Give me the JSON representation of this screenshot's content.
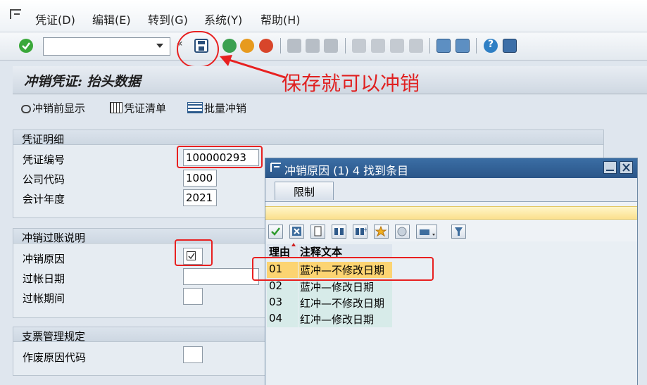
{
  "menu": {
    "items": [
      "凭证(D)",
      "编辑(E)",
      "转到(G)",
      "系统(Y)",
      "帮助(H)"
    ]
  },
  "command_field": {
    "value": ""
  },
  "page": {
    "title": "冲销凭证: 抬头数据",
    "annotation": "保存就可以冲销"
  },
  "app_toolbar": {
    "btn_preview": "冲销前显示",
    "btn_list": "凭证清单",
    "btn_mass": "批量冲销"
  },
  "group_doc": {
    "header": "凭证明细",
    "doc_number_label": "凭证编号",
    "doc_number_value": "100000293",
    "company_code_label": "公司代码",
    "company_code_value": "1000",
    "fiscal_year_label": "会计年度",
    "fiscal_year_value": "2021"
  },
  "group_posting": {
    "header": "冲销过账说明",
    "reason_label": "冲销原因",
    "reason_value": "",
    "posting_date_label": "过帐日期",
    "posting_date_value": "",
    "posting_period_label": "过帐期间",
    "posting_period_value": ""
  },
  "group_check": {
    "header": "支票管理规定",
    "void_reason_label": "作废原因代码",
    "void_reason_value": ""
  },
  "dialog": {
    "title": "冲销原因 (1)   4 找到条目",
    "tab_label": "限制",
    "columns": {
      "code": "理由",
      "text": "注释文本"
    },
    "rows": [
      {
        "code": "01",
        "text": "蓝冲—不修改日期"
      },
      {
        "code": "02",
        "text": "蓝冲—修改日期"
      },
      {
        "code": "03",
        "text": "红冲—不修改日期"
      },
      {
        "code": "04",
        "text": "红冲—修改日期"
      }
    ]
  },
  "colors": {
    "accent_red": "#e82020",
    "dialog_title": "#2a5588",
    "selected_row": "#fcd472"
  }
}
